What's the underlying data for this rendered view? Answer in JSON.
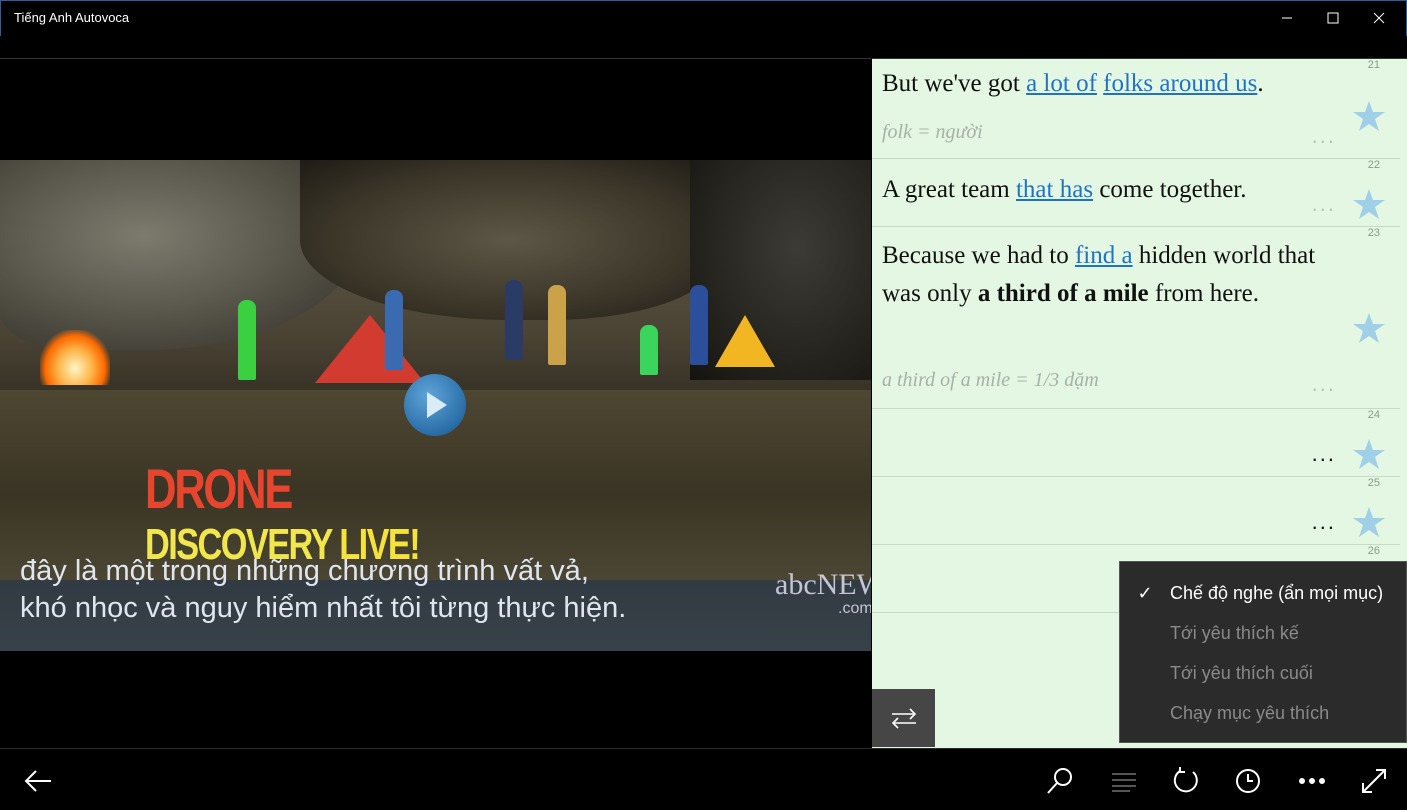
{
  "window": {
    "title": "Tiếng Anh Autovoca"
  },
  "video": {
    "subtitle_line1": "đây là một trong những chương trình vất vả,",
    "subtitle_line2": "khó nhọc và nguy hiểm nhất tôi từng thực hiện.",
    "logo_line1": "DRONE",
    "logo_line2a": "DISCOVERY",
    "logo_line2b": "LIVE!",
    "network_logo": "abcNEWS",
    "network_sub": ".com"
  },
  "transcript": [
    {
      "num": "21",
      "parts": [
        {
          "t": "But we've got ",
          "s": "plain"
        },
        {
          "t": "a lot of",
          "s": "hl"
        },
        {
          "t": " ",
          "s": "plain"
        },
        {
          "t": "folks around us",
          "s": "hl"
        },
        {
          "t": ".",
          "s": "plain"
        }
      ],
      "note": "folk = người",
      "dots": "..."
    },
    {
      "num": "22",
      "parts": [
        {
          "t": "A great team ",
          "s": "plain"
        },
        {
          "t": "that has",
          "s": "hl"
        },
        {
          "t": " come together.",
          "s": "plain"
        }
      ],
      "note": "",
      "dots": "..."
    },
    {
      "num": "23",
      "parts": [
        {
          "t": "Because we had to ",
          "s": "plain"
        },
        {
          "t": "find a",
          "s": "hl"
        },
        {
          "t": " hidden world that was only ",
          "s": "plain"
        },
        {
          "t": "a third of a mile",
          "s": "bold"
        },
        {
          "t": " from here.",
          "s": "plain"
        }
      ],
      "note": "a third of a mile = 1/3 dặm",
      "dots": "..."
    },
    {
      "num": "24",
      "parts": [],
      "note": "",
      "dots": "..."
    },
    {
      "num": "25",
      "parts": [],
      "note": "",
      "dots": "..."
    },
    {
      "num": "26",
      "parts": [],
      "note": "",
      "dots": ""
    }
  ],
  "menu": {
    "items": [
      {
        "label": "Chế độ nghe (ẩn mọi mục)",
        "checked": true,
        "enabled": true
      },
      {
        "label": "Tới yêu thích kế",
        "checked": false,
        "enabled": false
      },
      {
        "label": "Tới yêu thích cuối",
        "checked": false,
        "enabled": false
      },
      {
        "label": "Chạy mục yêu thích",
        "checked": false,
        "enabled": false
      }
    ]
  },
  "appbar": {
    "icons": [
      "back-arrow-icon",
      "search-icon",
      "subtitles-icon",
      "repeat-icon",
      "clock-icon",
      "more-icon",
      "fullscreen-icon"
    ]
  },
  "colors": {
    "panel_bg": "#e4f7e2",
    "highlight": "#1e73c8",
    "star": "#9fd0e8",
    "menu_bg": "#2b2b2b"
  }
}
